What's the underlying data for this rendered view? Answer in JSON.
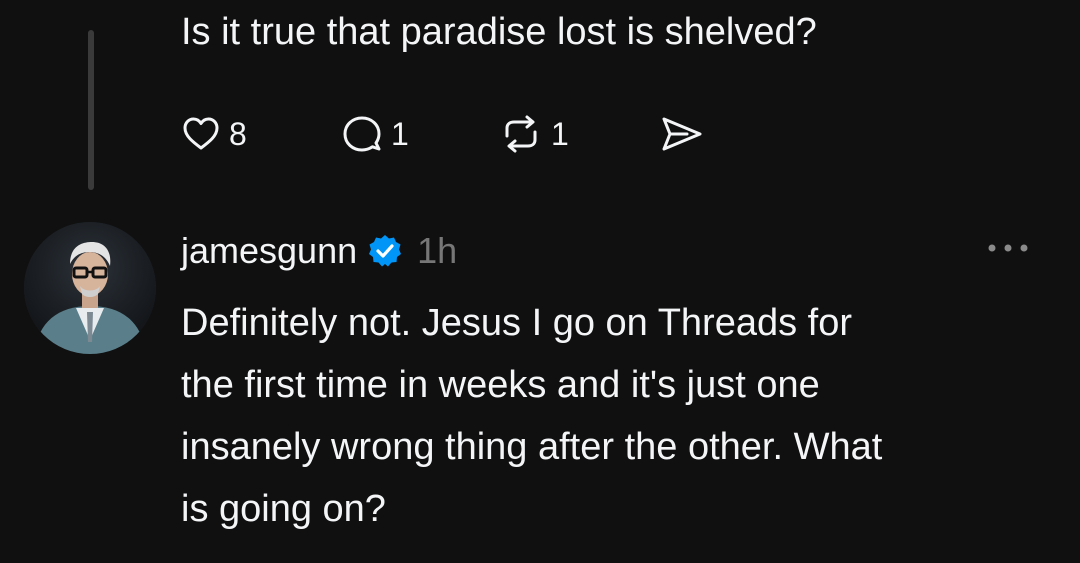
{
  "parent_post": {
    "text": "Is it true that paradise lost is shelved?",
    "actions": {
      "likes": "8",
      "replies": "1",
      "reposts": "1"
    },
    "icons": [
      "heart-icon",
      "reply-icon",
      "repost-icon",
      "share-icon"
    ]
  },
  "reply_post": {
    "username": "jamesgunn",
    "verified": true,
    "timestamp": "1h",
    "text_lines": [
      "Definitely not. Jesus I go on Threads for",
      "the first time in weeks and it's just one",
      "insanely wrong thing after the other. What",
      "is going on?"
    ],
    "icons": [
      "verified-badge-icon",
      "more-options-icon"
    ]
  },
  "colors": {
    "background": "#101010",
    "text": "#f3f5f7",
    "muted": "#777777",
    "verified": "#0095f6",
    "thread_line": "#3a3a3a"
  }
}
